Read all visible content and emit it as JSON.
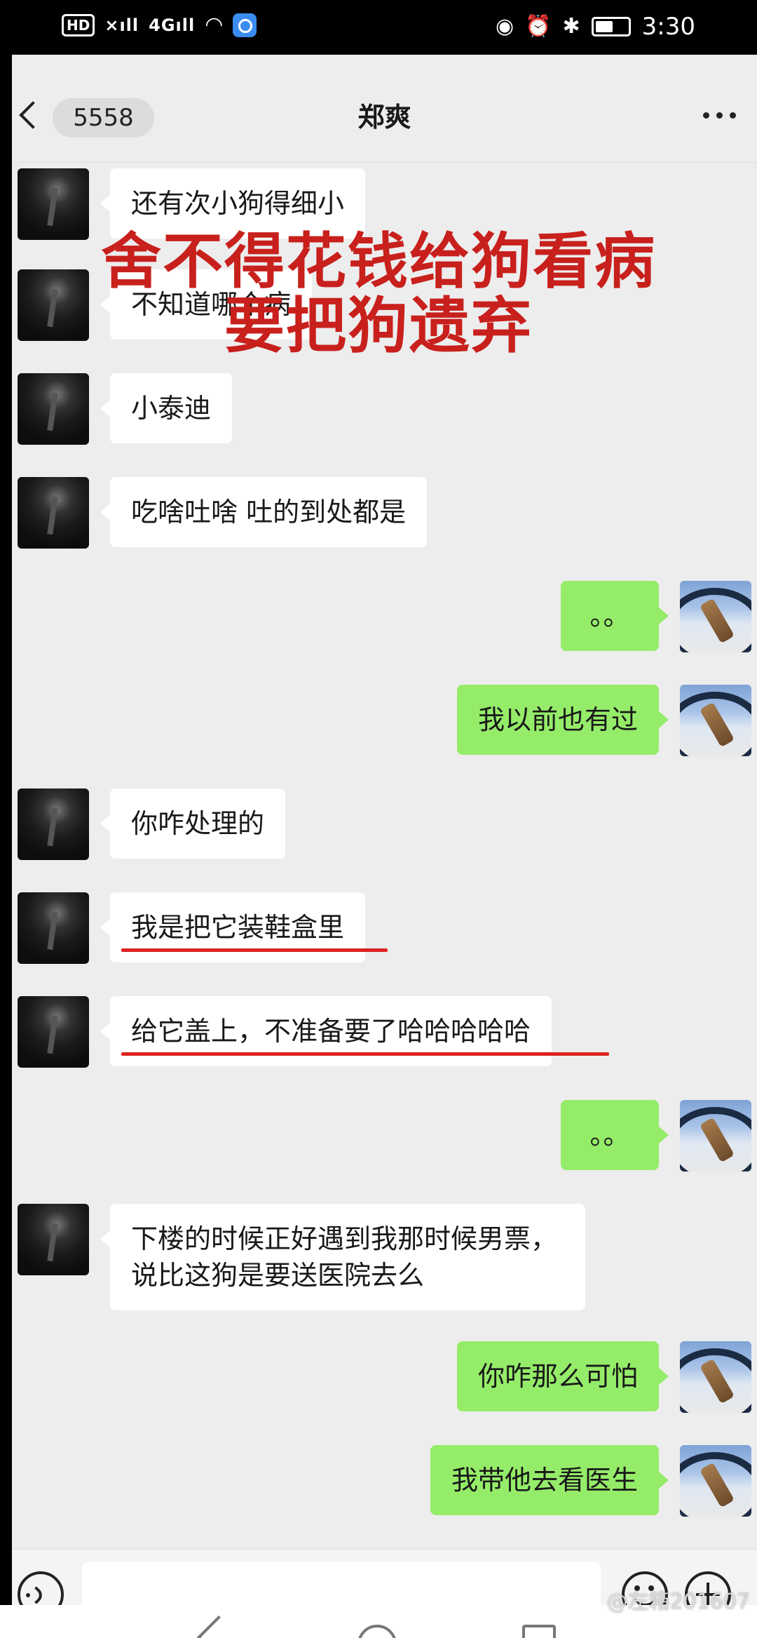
{
  "status_bar": {
    "hd": "HD",
    "signal_1": "×ıll",
    "signal_2": "4Gıll",
    "time": "3:30",
    "battery_level": 0.55,
    "icons": [
      "hd-icon",
      "signal-icon",
      "wifi-icon",
      "app-icon",
      "eye-icon",
      "alarm-icon",
      "bluetooth-icon",
      "battery-icon"
    ]
  },
  "header": {
    "unread_count": "5558",
    "title": "郑爽"
  },
  "overlay": {
    "line1": "舍不得花钱给狗看病",
    "line2": "要把狗遗弃"
  },
  "messages": [
    {
      "side": "left",
      "text": "还有次小狗得细小"
    },
    {
      "side": "left",
      "text": "不知道哪个病"
    },
    {
      "side": "left",
      "text": "小泰迪"
    },
    {
      "side": "left",
      "text": "吃啥吐啥 吐的到处都是"
    },
    {
      "side": "right",
      "text": "。。"
    },
    {
      "side": "right",
      "text": "我以前也有过"
    },
    {
      "side": "left",
      "text": "你咋处理的"
    },
    {
      "side": "left",
      "text": "我是把它装鞋盒里",
      "underlined": true
    },
    {
      "side": "left",
      "text": "给它盖上，不准备要了哈哈哈哈哈",
      "underlined": true
    },
    {
      "side": "right",
      "text": "。。"
    },
    {
      "side": "left",
      "text": "下楼的时候正好遇到我那时候男票，说比这狗是要送医院去么"
    },
    {
      "side": "right",
      "text": "你咋那么可怕"
    },
    {
      "side": "right",
      "text": "我带他去看医生"
    }
  ],
  "colors": {
    "sent_bubble": "#95ec69",
    "received_bubble": "#ffffff",
    "overlay_text": "#c8201c",
    "underline": "#dd2222",
    "background": "#ededed"
  },
  "input_bar": {
    "icons": [
      "voice-icon",
      "emoji-icon",
      "plus-icon"
    ]
  },
  "watermark": "@左箱201607"
}
